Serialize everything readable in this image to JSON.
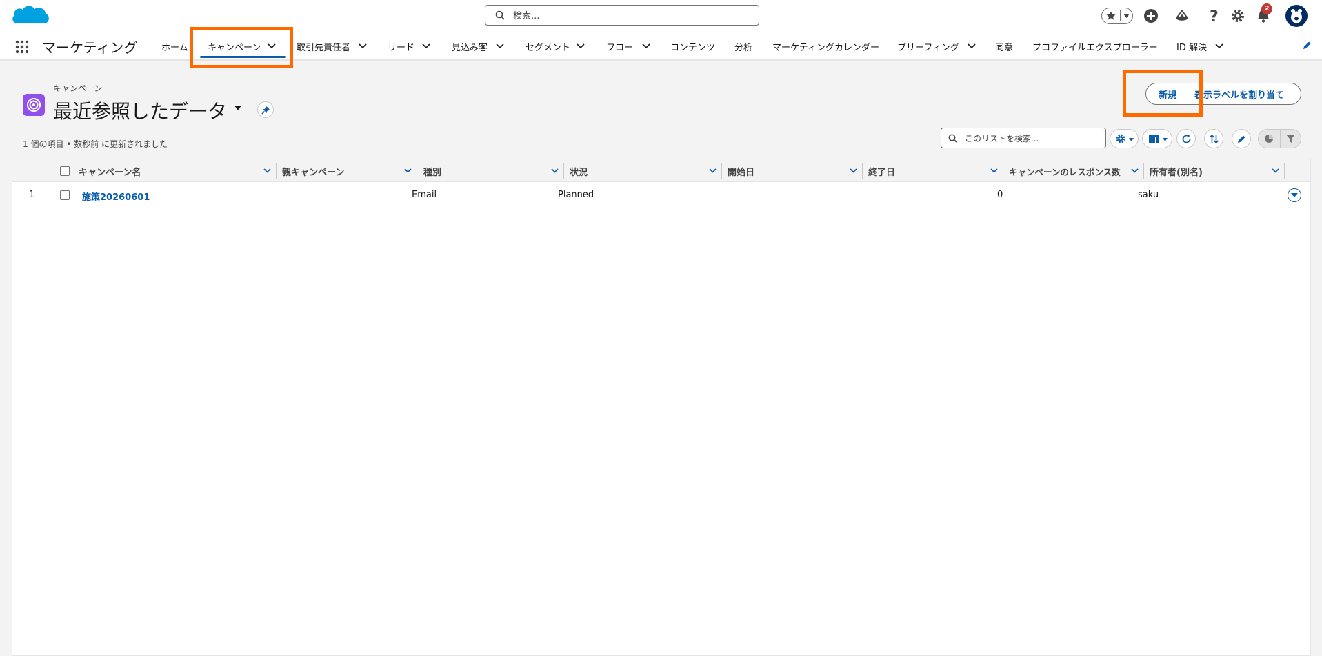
{
  "header": {
    "search_placeholder": "検索...",
    "notification_count": "2"
  },
  "nav": {
    "app_name": "マーケティング",
    "items": [
      {
        "label": "ホーム"
      },
      {
        "label": "キャンペーン"
      },
      {
        "label": "取引先責任者"
      },
      {
        "label": "リード"
      },
      {
        "label": "見込み客"
      },
      {
        "label": "セグメント"
      },
      {
        "label": "フロー"
      },
      {
        "label": "コンテンツ"
      },
      {
        "label": "分析"
      },
      {
        "label": "マーケティングカレンダー"
      },
      {
        "label": "ブリーフィング"
      },
      {
        "label": "同意"
      },
      {
        "label": "プロファイルエクスプローラー"
      },
      {
        "label": "ID 解決"
      }
    ]
  },
  "page": {
    "object_label": "キャンペーン",
    "list_view_name": "最近参照したデータ",
    "meta": "1 個の項目 • 数秒前 に更新されました",
    "new_button": "新規",
    "assign_label_button": "表示ラベルを割り当て",
    "list_search_placeholder": "このリストを検索..."
  },
  "table": {
    "columns": [
      "キャンペーン名",
      "親キャンペーン",
      "種別",
      "状況",
      "開始日",
      "終了日",
      "キャンペーンのレスポンス数",
      "所有者(別名)"
    ],
    "rows": [
      {
        "num": "1",
        "name": "施策20260601",
        "parent": "",
        "type": "Email",
        "status": "Planned",
        "start": "",
        "end": "",
        "responses": "0",
        "owner": "saku"
      }
    ]
  },
  "colors": {
    "brand_blue": "#0b5cab",
    "highlight_orange": "#ff6a00",
    "campaign_icon_purple": "#9050e9",
    "notification_red": "#c23934"
  }
}
